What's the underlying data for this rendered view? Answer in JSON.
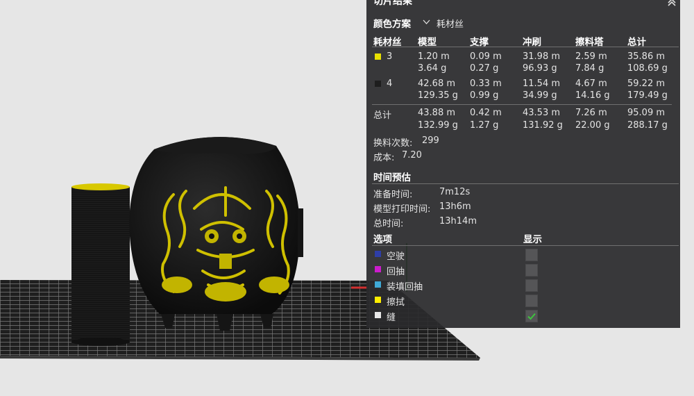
{
  "panel": {
    "title": "切片结果",
    "color_scheme_label": "颜色方案",
    "color_scheme_value": "耗材丝",
    "table": {
      "headers": [
        "耗材丝",
        "模型",
        "支撑",
        "冲刷",
        "擦料塔",
        "总计"
      ],
      "rows": [
        {
          "filament": "3",
          "swatch": "#e8e000",
          "length": [
            "1.20 m",
            "0.09 m",
            "31.98 m",
            "2.59 m",
            "35.86 m"
          ],
          "weight": [
            "3.64 g",
            "0.27 g",
            "96.93 g",
            "7.84 g",
            "108.69 g"
          ]
        },
        {
          "filament": "4",
          "swatch": "#1e1e1e",
          "length": [
            "42.68 m",
            "0.33 m",
            "11.54 m",
            "4.67 m",
            "59.22 m"
          ],
          "weight": [
            "129.35 g",
            "0.99 g",
            "34.99 g",
            "14.16 g",
            "179.49 g"
          ]
        }
      ],
      "total": {
        "label": "总计",
        "length": [
          "43.88 m",
          "0.42 m",
          "43.53 m",
          "7.26 m",
          "95.09 m"
        ],
        "weight": [
          "132.99 g",
          "1.27 g",
          "131.92 g",
          "22.00 g",
          "288.17 g"
        ]
      }
    },
    "change_count_label": "换料次数:",
    "change_count_value": "299",
    "cost_label": "成本:",
    "cost_value": "7.20",
    "time_section_title": "时间预估",
    "times": [
      {
        "label": "准备时间:",
        "value": "7m12s"
      },
      {
        "label": "模型打印时间:",
        "value": "13h6m"
      },
      {
        "label": "总时间:",
        "value": "13h14m"
      }
    ],
    "options_header": "选项",
    "display_header": "显示",
    "options": [
      {
        "label": "空驶",
        "color": "#2e3ea8",
        "checked": false
      },
      {
        "label": "回抽",
        "color": "#cc1ccc",
        "checked": false
      },
      {
        "label": "装填回抽",
        "color": "#3fa9d6",
        "checked": false
      },
      {
        "label": "擦拭",
        "color": "#ffee00",
        "checked": false
      },
      {
        "label": "缝",
        "color": "#e8e8e8",
        "checked": true
      }
    ]
  }
}
